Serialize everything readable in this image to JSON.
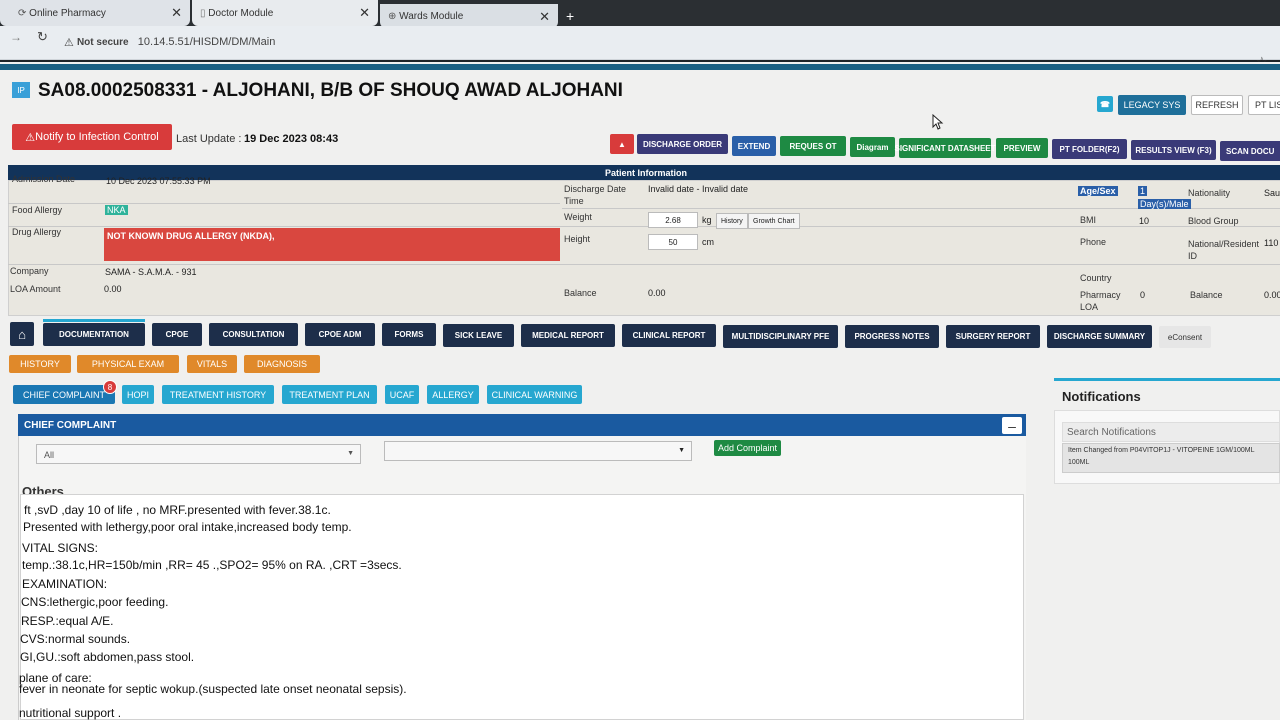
{
  "browser": {
    "tabs": [
      {
        "label": "Online Pharmacy"
      },
      {
        "label": "Doctor Module"
      },
      {
        "label": "Wards Module"
      }
    ],
    "new_tab": "+",
    "security": "Not secure",
    "url": "10.14.5.51/HISDM/DM/Main"
  },
  "patient": {
    "badge": "IP",
    "title": "SA08.0002508331 - ALJOHANI, B/B OF SHOUQ AWAD ALJOHANI",
    "notify": "Notify to Infection Control",
    "last_update_label": "Last Update :",
    "last_update": "19 Dec 2023 08:43"
  },
  "top_buttons": {
    "legacy": "LEGACY SYS",
    "refresh": "REFRESH",
    "ptlist": "PT LIS"
  },
  "actions": [
    "DISCHARGE ORDER",
    "EXTEND",
    "REQUES OT",
    "Diagram",
    "SIGNIFICANT DATASHEET",
    "PREVIEW",
    "PT FOLDER(F2)",
    "RESULTS VIEW (F3)",
    "SCAN DOCU"
  ],
  "info": {
    "header": "Patient Information",
    "admission_label": "Admission Date",
    "admission": "10 Dec 2023 07:55:33 PM",
    "food_label": "Food Allergy",
    "food": "NKA",
    "drug_label": "Drug Allergy",
    "drug": "NOT KNOWN DRUG ALLERGY (NKDA),",
    "company_label": "Company",
    "company": "SAMA - S.A.M.A. - 931",
    "loa_label": "LOA Amount",
    "loa": "0.00",
    "discharge_label": "Discharge Date Time",
    "discharge": "Invalid date - Invalid date",
    "weight_label": "Weight",
    "weight": "2.68",
    "weight_unit": "kg",
    "history": "History",
    "growth": "Growth Chart",
    "height_label": "Height",
    "height": "50",
    "height_unit": "cm",
    "balance_label": "Balance",
    "balance": "0.00",
    "agesex_label": "Age/Sex",
    "agesex_1": "1",
    "agesex_2": "Day(s)/Male",
    "nationality_label": "Nationality",
    "nationality": "Sau",
    "bmi_label": "BMI",
    "bmi": "10",
    "blood_label": "Blood Group",
    "phone_label": "Phone",
    "natid_label": "National/Resident ID",
    "natid": "110",
    "country_label": "Country",
    "pharm_label": "Pharmacy LOA",
    "pharm": "0",
    "bal2_label": "Balance",
    "bal2": "0.00"
  },
  "nav": [
    "DOCUMENTATION",
    "CPOE",
    "CONSULTATION",
    "CPOE ADM",
    "FORMS",
    "SICK LEAVE",
    "MEDICAL REPORT",
    "CLINICAL REPORT",
    "MULTIDISCIPLINARY PFE",
    "PROGRESS NOTES",
    "SURGERY REPORT",
    "DISCHARGE SUMMARY",
    "eConsent"
  ],
  "sub": [
    "HISTORY",
    "PHYSICAL EXAM",
    "VITALS",
    "DIAGNOSIS"
  ],
  "ctabs": [
    "CHIEF COMPLAINT",
    "HOPI",
    "TREATMENT HISTORY",
    "TREATMENT PLAN",
    "UCAF",
    "ALLERGY",
    "CLINICAL WARNING"
  ],
  "ctab_badge": "8",
  "panel": {
    "title": "CHIEF COMPLAINT",
    "select1": "All",
    "add": "Add Complaint",
    "others": "Others"
  },
  "notes": [
    "ft ,svD ,day 10 of life , no MRF.presented with fever.38.1c.",
    "Presented with lethergy,poor oral intake,increased body temp.",
    "VITAL SIGNS:",
    "temp.:38.1c,HR=150b/min   ,RR=  45 .,SPO2= 95% on RA.  ,CRT =3secs.",
    "EXAMINATION:",
    "CNS:lethergic,poor feeding.",
    "RESP.:equal A/E.",
    "CVS:normal sounds.",
    "GI,GU.:soft abdomen,pass stool.",
    "plane of care:",
    "fever in neonate for septic wokup.(suspected late onset neonatal sepsis).",
    "nutritional support ."
  ],
  "notifications": {
    "title": "Notifications",
    "search": "Search Notifications",
    "item1": "Item Changed from P04VITOP1J - VITOPEINE 1GM/100ML",
    "item2": "100ML"
  }
}
